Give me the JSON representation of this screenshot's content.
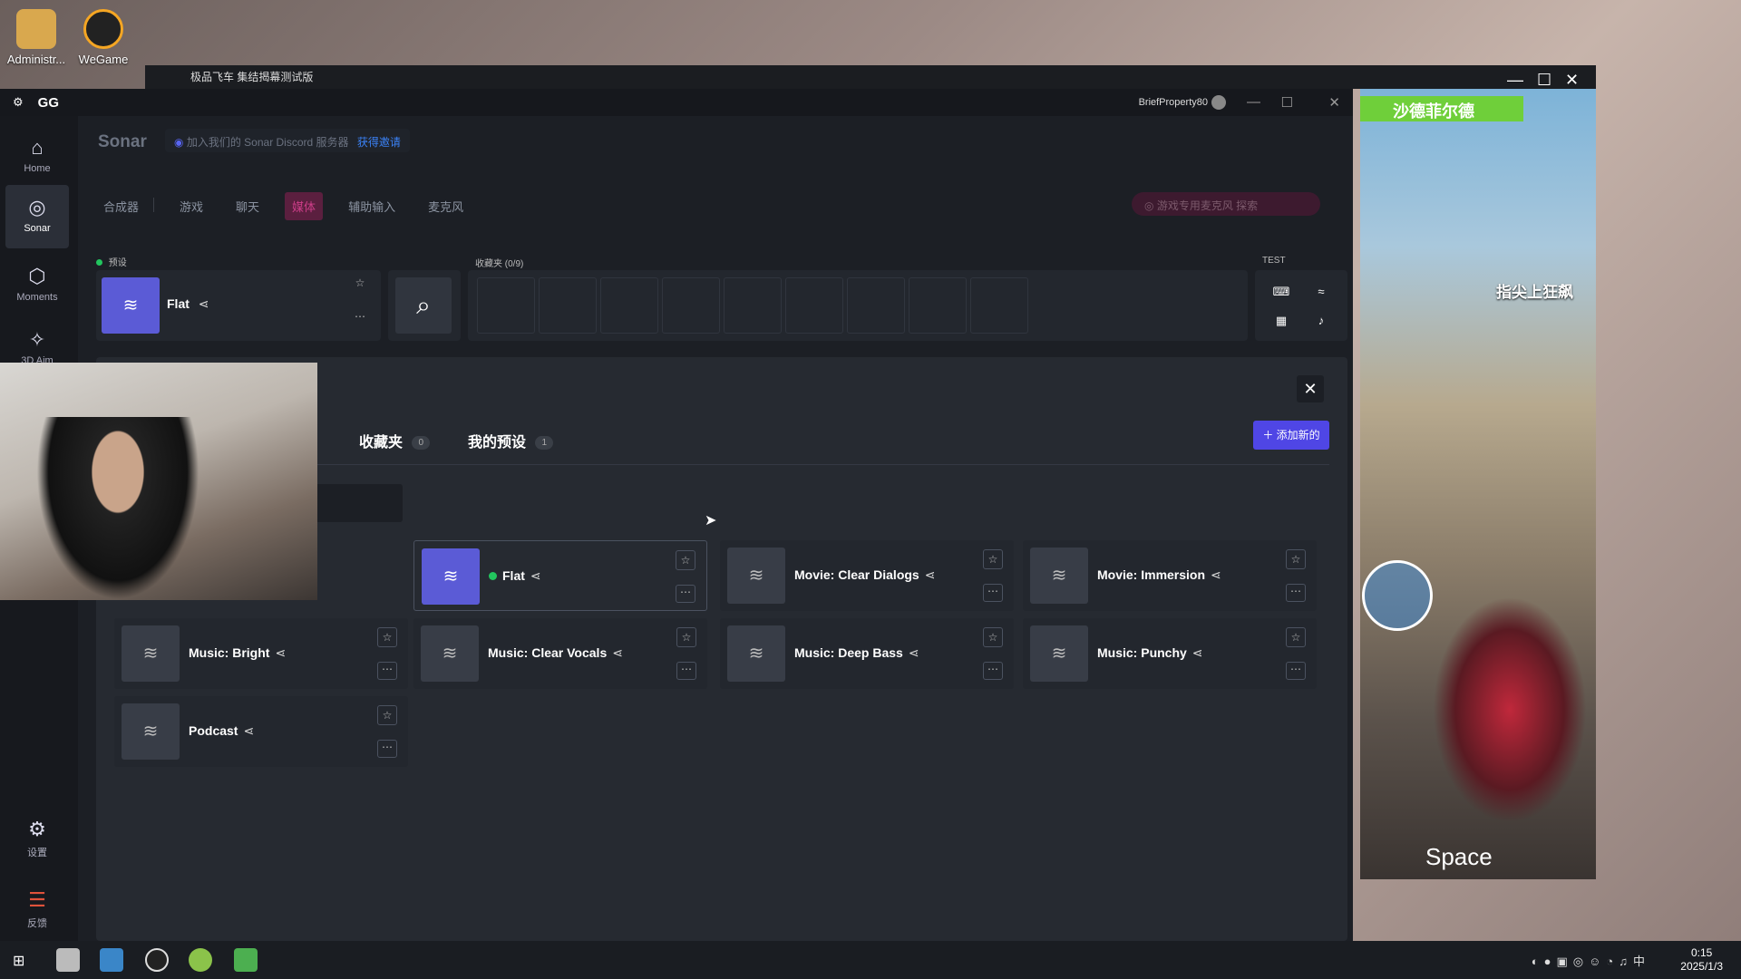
{
  "desktop": {
    "icons": [
      {
        "label": "Administr..."
      },
      {
        "label": "WeGame"
      }
    ]
  },
  "game": {
    "title": "极品飞车 集结揭幕测试版",
    "labels": [
      "沙德菲尔德",
      "指尖上狂飙",
      "Space"
    ]
  },
  "app": {
    "logo": "GG",
    "user": "BriefProperty80",
    "nav": [
      {
        "label": "Home",
        "glyph": "⌂"
      },
      {
        "label": "Sonar",
        "glyph": "◎"
      },
      {
        "label": "Moments",
        "glyph": "⬡"
      },
      {
        "label": "3D Aim",
        "glyph": "✧"
      },
      {
        "label": "设置",
        "glyph": "⚙"
      },
      {
        "label": "反馈",
        "glyph": "☰"
      }
    ],
    "page_title": "Sonar",
    "discord": {
      "text": "加入我们的 Sonar Discord 服务器",
      "link": "获得邀请"
    },
    "tabs": [
      "合成器",
      "游戏",
      "聊天",
      "媒体",
      "辅助输入",
      "麦克风"
    ],
    "active_tab": "媒体",
    "mic_search_placeholder": "游戏专用麦克风 探索",
    "preset_label": "预设",
    "current_preset": "Flat",
    "favorites_label": "收藏夹 (0/9)",
    "test_label": "TEST",
    "dialog": {
      "tabs": [
        {
          "label": "收藏夹",
          "count": "0"
        },
        {
          "label": "我的预设",
          "count": "1"
        }
      ],
      "add_button": "＋ 添加新的",
      "presets": [
        {
          "name": "Flat",
          "active": true
        },
        {
          "name": "Movie: Clear Dialogs"
        },
        {
          "name": "Movie: Immersion"
        },
        {
          "name": "Music: Bright"
        },
        {
          "name": "Music: Clear Vocals"
        },
        {
          "name": "Music: Deep Bass"
        },
        {
          "name": "Music: Punchy"
        },
        {
          "name": "Podcast"
        }
      ]
    }
  },
  "clock": {
    "time": "0:15",
    "date": "2025/1/3"
  },
  "colors": {
    "accent": "#5b5bd6",
    "media_tab": "#cc3d88",
    "add_button": "#4f46e5"
  }
}
